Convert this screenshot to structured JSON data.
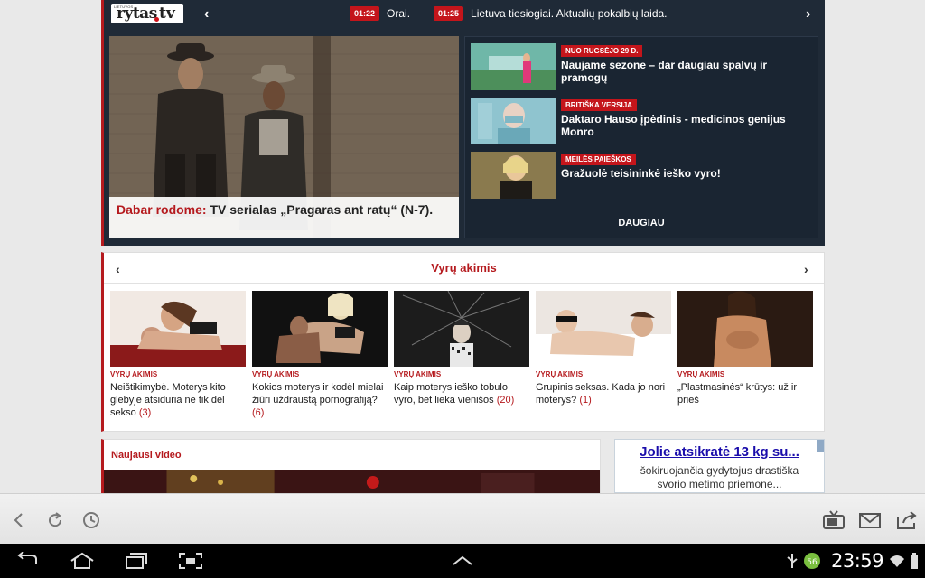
{
  "ticker": {
    "logo_small": "LIETUVOS",
    "logo_main": "rytas",
    "logo_tv": "tv",
    "items": [
      {
        "time": "01:22",
        "text": "Orai."
      },
      {
        "time": "01:25",
        "text": "Lietuva tiesiogiai. Aktualių pokalbių laida."
      }
    ]
  },
  "hero": {
    "prefix": "Dabar rodome:",
    "title": " TV serialas „Pragaras ant ratų“ (N-7)."
  },
  "side": {
    "items": [
      {
        "tag": "Nuo rugsėjo 29 d.",
        "title": "Naujame sezone – dar daugiau spalvų ir pramogų"
      },
      {
        "tag": "Britiška versija",
        "title": "Daktaro Hauso įpėdinis - medicinos genijus Monro"
      },
      {
        "tag": "Meilės paieškos",
        "title": "Gražuolė teisininkė ieško vyro!"
      }
    ],
    "more": "DAUGIAU"
  },
  "carousel": {
    "title": "Vyrų akimis",
    "cards": [
      {
        "tag": "VYRŲ AKIMIS",
        "title": "Neištikimybė. Moterys kito glėbyje atsiduria ne tik dėl sekso",
        "count": "(3)"
      },
      {
        "tag": "VYRŲ AKIMIS",
        "title": "Kokios moterys ir kodėl mielai žiūri uždraustą pornografiją?",
        "count": "(6)"
      },
      {
        "tag": "VYRŲ AKIMIS",
        "title": "Kaip moterys ieško tobulo vyro, bet lieka vienišos",
        "count": "(20)"
      },
      {
        "tag": "VYRŲ AKIMIS",
        "title": "Grupinis seksas. Kada jo nori moterys?",
        "count": "(1)"
      },
      {
        "tag": "VYRŲ AKIMIS",
        "title": "„Plastmasinės“ krūtys: už ir prieš",
        "count": ""
      }
    ]
  },
  "video": {
    "title": "Naujausi video"
  },
  "ad": {
    "headline": "Jolie atsikratė 13 kg su...",
    "line1": "šokiruojančia gydytojus drastiška",
    "line2": "svorio metimo priemone..."
  },
  "status": {
    "time": "23:59",
    "badge": "56"
  }
}
